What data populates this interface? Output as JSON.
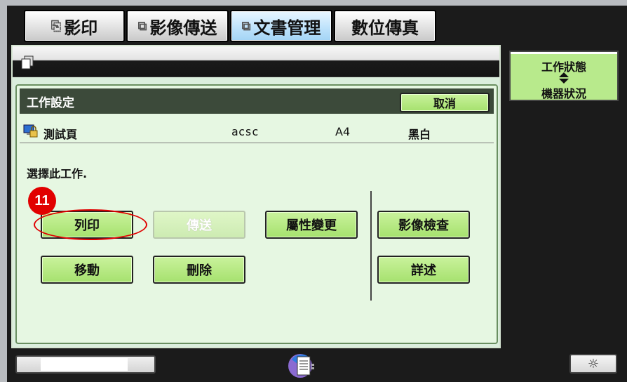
{
  "tabs": [
    {
      "label": "影印",
      "icon": "copy-icon"
    },
    {
      "label": "影像傳送",
      "icon": "image-send-icon"
    },
    {
      "label": "文書管理",
      "icon": "document-filing-icon"
    },
    {
      "label": "數位傳真",
      "icon": ""
    }
  ],
  "job_settings": {
    "header": "工作設定",
    "cancel_label": "取消",
    "job": {
      "name": "測試頁",
      "user": "acsc",
      "paper": "A4",
      "color": "黑白"
    },
    "instruction": "選擇此工作.",
    "buttons": {
      "print": "列印",
      "send": "傳送",
      "property_change": "屬性變更",
      "image_check": "影像檢查",
      "move": "移動",
      "delete": "刪除",
      "detail": "詳述"
    }
  },
  "step_number": "11",
  "status_panel": {
    "job_status": "工作狀態",
    "machine_status": "機器狀況"
  },
  "colors": {
    "accent_green": "#a6e16e",
    "highlight_red": "#e10000",
    "active_tab_blue": "#bfe3fb"
  }
}
